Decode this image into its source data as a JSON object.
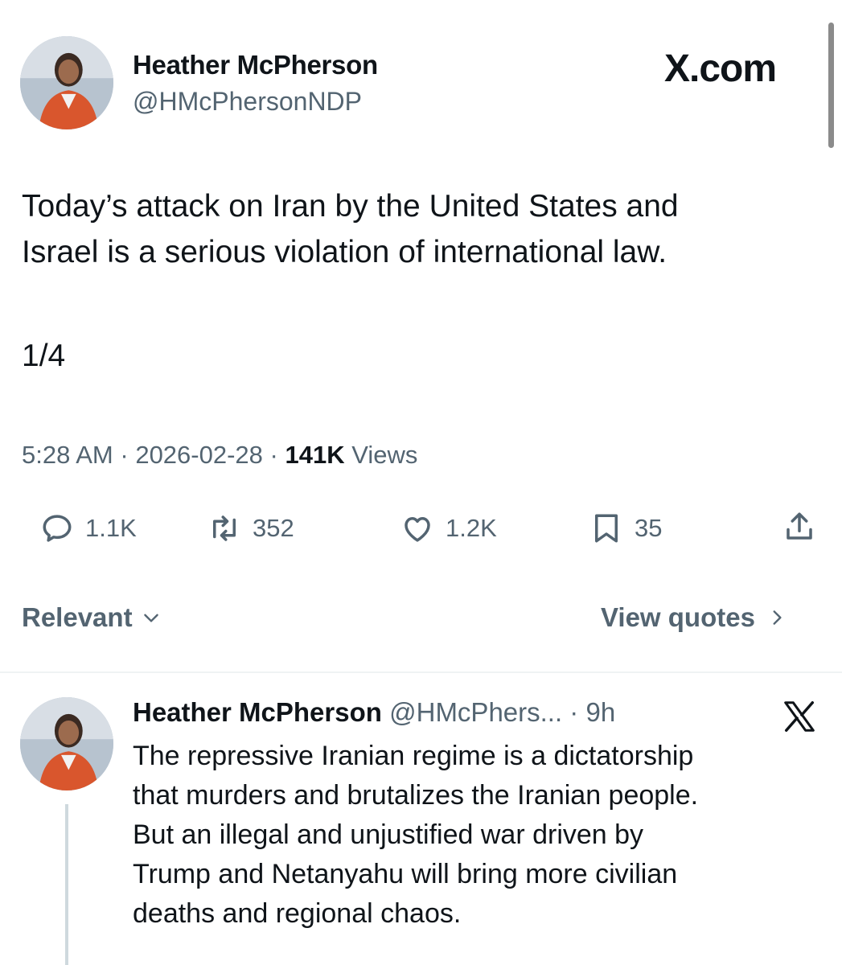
{
  "tweet": {
    "author_name": "Heather McPherson",
    "author_handle": "@HMcPhersonNDP",
    "site_badge": "X.com",
    "text_line1": "Today’s attack on Iran by the United States and",
    "text_line2": "Israel is a serious violation of international law.",
    "thread_index": "1/4",
    "time": "5:28 AM",
    "date": "2026-02-28",
    "views_count": "141K",
    "views_label": "Views",
    "separator": "·",
    "replies": "1.1K",
    "reposts": "352",
    "likes": "1.2K",
    "bookmarks": "35"
  },
  "replies_bar": {
    "sort_label": "Relevant",
    "view_quotes_label": "View quotes"
  },
  "reply": {
    "author_name": "Heather McPherson",
    "handle_time": "@HMcPhers... · 9h",
    "lines": [
      "The repressive Iranian regime is a dictatorship",
      "that murders and brutalizes the Iranian people.",
      "But an illegal and unjustified war driven by",
      "Trump and Netanyahu will bring more civilian",
      "deaths and regional chaos."
    ]
  },
  "colors": {
    "text_primary": "#0f1419",
    "text_secondary": "#536471",
    "divider": "#eff3f4"
  },
  "icons": [
    "reply-icon",
    "repost-icon",
    "like-icon",
    "bookmark-icon",
    "share-icon",
    "x-logo-icon",
    "chevron-down-icon",
    "chevron-right-icon"
  ]
}
